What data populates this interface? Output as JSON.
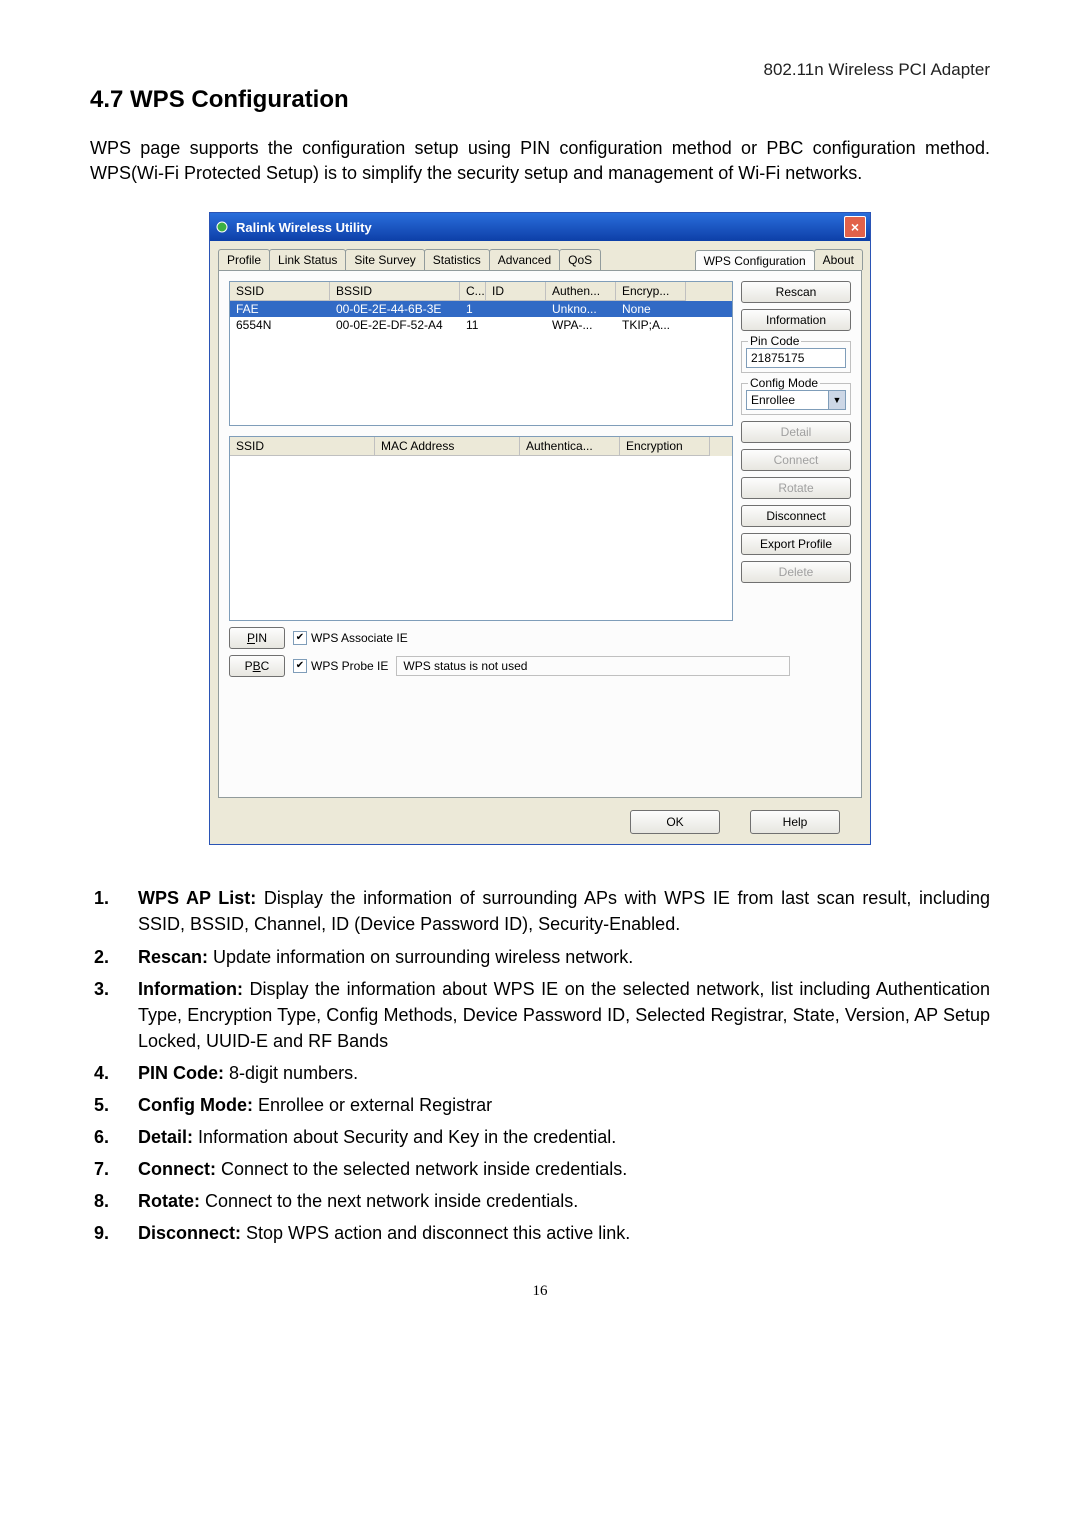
{
  "doc": {
    "header": "802.11n Wireless PCI Adapter",
    "section_title": "4.7 WPS Configuration",
    "intro": "WPS page supports the configuration setup using PIN configuration method or PBC configuration method.  WPS(Wi-Fi Protected Setup) is to simplify the security setup and management of Wi-Fi networks.",
    "page_number": "16"
  },
  "dialog": {
    "title": "Ralink Wireless Utility",
    "tabs": [
      "Profile",
      "Link Status",
      "Site Survey",
      "Statistics",
      "Advanced",
      "QoS",
      "WPS Configuration",
      "About"
    ],
    "active_tab": "WPS Configuration",
    "ap_list": {
      "headers": {
        "ssid": "SSID",
        "bssid": "BSSID",
        "ch": "C...",
        "id": "ID",
        "auth": "Authen...",
        "enc": "Encryp..."
      },
      "rows": [
        {
          "ssid": "FAE",
          "bssid": "00-0E-2E-44-6B-3E",
          "ch": "1",
          "id": "",
          "auth": "Unkno...",
          "enc": "None",
          "selected": true
        },
        {
          "ssid": "6554N",
          "bssid": "00-0E-2E-DF-52-A4",
          "ch": "11",
          "id": "",
          "auth": "WPA-...",
          "enc": "TKIP;A...",
          "selected": false
        }
      ]
    },
    "cred_list": {
      "headers": {
        "ssid": "SSID",
        "mac": "MAC Address",
        "auth": "Authentica...",
        "enc": "Encryption"
      }
    },
    "side": {
      "rescan": "Rescan",
      "information": "Information",
      "pin_code_label": "Pin Code",
      "pin_code_value": "21875175",
      "config_mode_label": "Config Mode",
      "config_mode_value": "Enrollee",
      "detail": "Detail",
      "connect": "Connect",
      "rotate": "Rotate",
      "disconnect": "Disconnect",
      "export_profile": "Export Profile",
      "delete": "Delete"
    },
    "bottom": {
      "pin": "PIN",
      "pbc": "PBC",
      "wps_assoc_ie": "WPS Associate IE",
      "wps_probe_ie": "WPS Probe IE",
      "status": "WPS status is not used"
    },
    "footer": {
      "ok": "OK",
      "help": "Help"
    }
  },
  "items": [
    {
      "term": "WPS AP List:",
      "text": " Display the information of surrounding APs with WPS IE from last scan result, including SSID, BSSID, Channel, ID (Device Password ID), Security-Enabled."
    },
    {
      "term": "Rescan:",
      "text": " Update information on surrounding wireless network."
    },
    {
      "term": "Information:",
      "text": " Display the information about WPS IE on the selected network, list including Authentication Type, Encryption Type, Config Methods, Device Password ID, Selected Registrar, State, Version, AP Setup Locked, UUID-E and RF Bands"
    },
    {
      "term": "PIN Code:",
      "text": " 8-digit numbers."
    },
    {
      "term": "Config Mode:",
      "text": " Enrollee or external Registrar"
    },
    {
      "term": "Detail:",
      "text": " Information about Security and Key in the credential."
    },
    {
      "term": "Connect:",
      "text": " Connect to the selected network inside credentials."
    },
    {
      "term": "Rotate:",
      "text": " Connect to the next network inside credentials."
    },
    {
      "term": "Disconnect:",
      "text": " Stop WPS action and disconnect this active link."
    }
  ]
}
